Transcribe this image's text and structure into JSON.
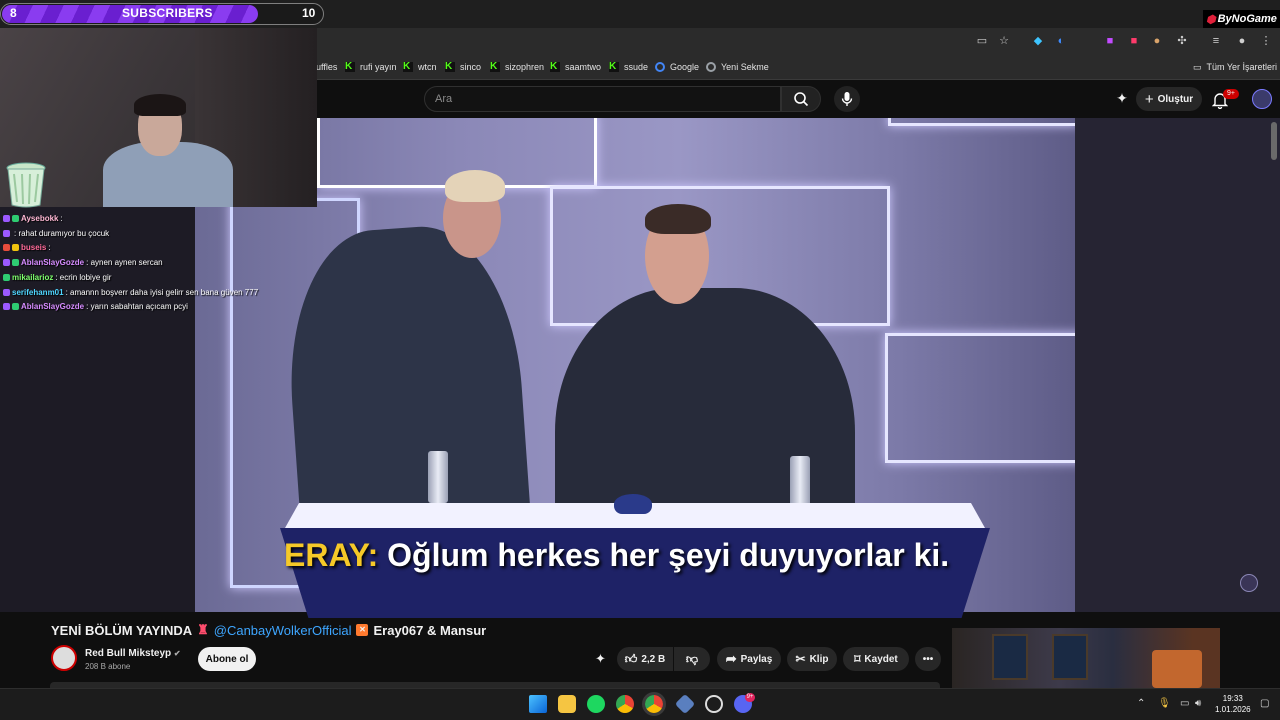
{
  "overlay": {
    "sub_goal_current": "8",
    "sub_goal_label": "SUBSCRIBERS",
    "sub_goal_target": "10",
    "sub_goal_progress": 0.8,
    "sponsor_brand": "ByNoGame"
  },
  "chat": [
    {
      "user": "Aysebokk",
      "message": ":",
      "color": "#ffb8d4"
    },
    {
      "user": "",
      "message": ": rahat duramıyor bu çocuk",
      "color": "#ff3b3b"
    },
    {
      "user": "buseis",
      "message": ":",
      "color": "#ff6b9a"
    },
    {
      "user": "AblanSlayGozde",
      "message": ": aynen aynen sercan",
      "color": "#d68cff"
    },
    {
      "user": "mikailarioz",
      "message": ": ecrin lobiye gir",
      "color": "#7dff6b"
    },
    {
      "user": "serifehanm01",
      "message": ": amannn boşverr daha iyisi gelirr sen bana güven 777",
      "color": "#4fd6ff"
    },
    {
      "user": "AblanSlayGozde",
      "message": ": yarın sabahtan açıcam pcyi",
      "color": "#d68cff"
    }
  ],
  "bookmarks": [
    {
      "label": "uffles",
      "icon": "none"
    },
    {
      "label": "rufi yayın",
      "icon": "kick-icon"
    },
    {
      "label": "wtcn",
      "icon": "kick-icon"
    },
    {
      "label": "sinco",
      "icon": "kick-icon"
    },
    {
      "label": "sizophren",
      "icon": "kick-icon"
    },
    {
      "label": "saamtwo",
      "icon": "kick-icon"
    },
    {
      "label": "ssude",
      "icon": "kick-icon"
    },
    {
      "label": "Google",
      "icon": "google-icon"
    },
    {
      "label": "Yeni Sekme",
      "icon": "globe-icon"
    }
  ],
  "all_bookmarks_label": "Tüm Yer İşaretleri",
  "youtube": {
    "search_placeholder": "Ara",
    "create_label": "Oluştur",
    "notification_count": "9+"
  },
  "video": {
    "subtitle_speaker": "ERAY:",
    "subtitle_text": "Oğlum herkes her şeyi duyuyorlar ki.",
    "title_prefix": "YENİ BÖLÜM YAYINDA",
    "title_mention": "@CanbayWolkerOfficial",
    "title_suffix": "Eray067 & Mansur",
    "channel_name": "Red Bull Mikstеyp",
    "channel_subs": "208 B abone",
    "subscribe_label": "Abone ol",
    "like_count": "2,2 B",
    "share_label": "Paylaş",
    "clip_label": "Klip",
    "save_label": "Kaydet"
  },
  "taskbar": {
    "time": "19:33",
    "date": "1.01.2026",
    "discord_badge": "9+"
  },
  "colors": {
    "accent_purple": "#8a3cf0",
    "yt_red": "#cc0000",
    "subtitle_yellow": "#f6c928",
    "link_blue": "#3ea6ff"
  }
}
